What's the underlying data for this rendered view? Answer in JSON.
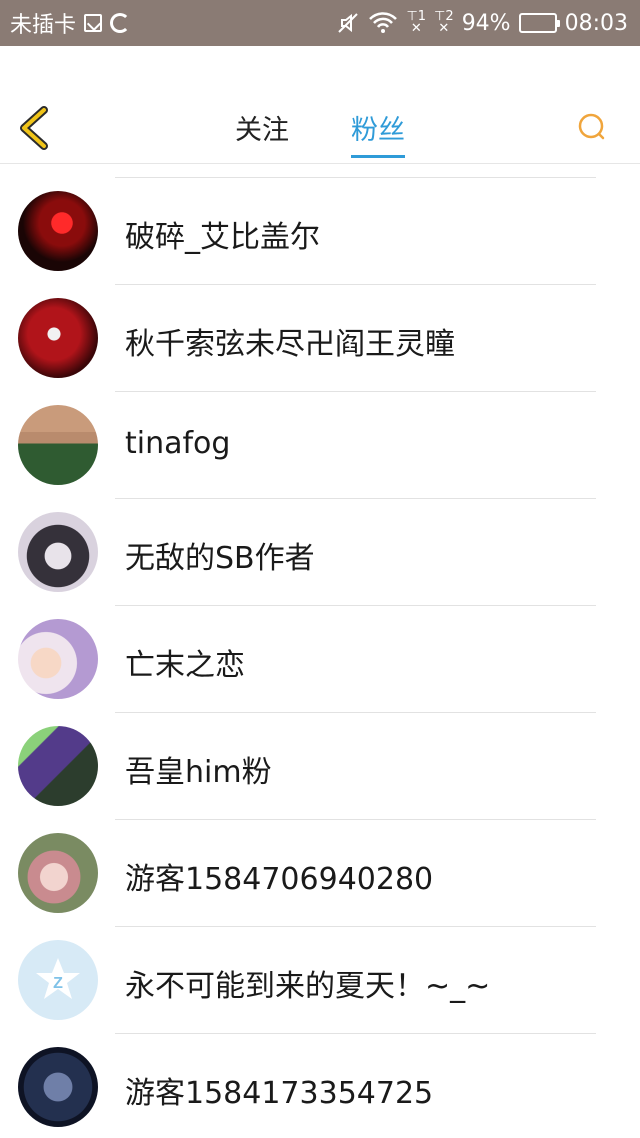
{
  "status_bar": {
    "carrier": "未插卡",
    "sig1": "1",
    "sig2": "2",
    "battery": "94%",
    "battery_level": 0.94,
    "time": "08:03"
  },
  "header": {
    "tabs": [
      {
        "label": "关注"
      },
      {
        "label": "粉丝"
      }
    ],
    "active_tab": "粉丝"
  },
  "fans": [
    {
      "name": "破碎_艾比盖尔"
    },
    {
      "name": "秋千索弦未尽卍阎王灵瞳"
    },
    {
      "name": "tinafog"
    },
    {
      "name": "无敌的SB作者"
    },
    {
      "name": "亡末之恋"
    },
    {
      "name": "吾皇him粉"
    },
    {
      "name": "游客1584706940280"
    },
    {
      "name": "永不可能到来的夏天！~_~"
    },
    {
      "name": "游客1584173354725"
    }
  ],
  "colors": {
    "accent": "#2f9bd8",
    "back_arrow": "#f0c419",
    "search_icon": "#f0a53c",
    "status_bar_bg": "#8a7b74"
  },
  "icons": {
    "back": "chevron-left-icon",
    "search": "search-icon"
  }
}
